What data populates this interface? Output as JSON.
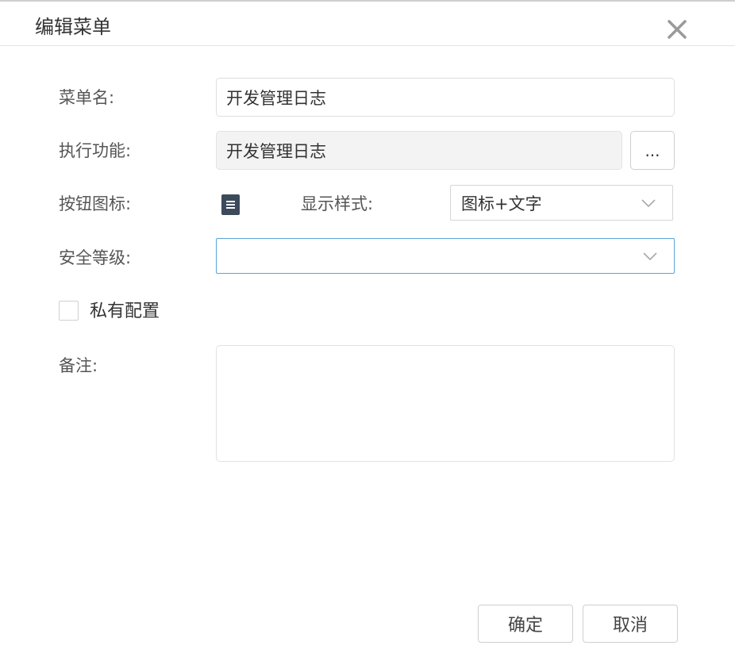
{
  "dialog": {
    "title": "编辑菜单",
    "close_icon": "close-x-icon"
  },
  "form": {
    "menu_name": {
      "label": "菜单名:",
      "value": "开发管理日志"
    },
    "function": {
      "label": "执行功能:",
      "value": "开发管理日志",
      "browse_label": "..."
    },
    "button_icon": {
      "label": "按钮图标:",
      "icon": "list-document-icon"
    },
    "display_style": {
      "label": "显示样式:",
      "selected": "图标+文字",
      "dropdown_icon": "chevron-down-icon"
    },
    "security_level": {
      "label": "安全等级:",
      "selected": "",
      "dropdown_icon": "chevron-down-icon"
    },
    "private_config": {
      "label": "私有配置",
      "checked": false
    },
    "remark": {
      "label": "备注:",
      "value": ""
    }
  },
  "footer": {
    "confirm_label": "确定",
    "cancel_label": "取消"
  },
  "colors": {
    "focus_border": "#5aa5d8",
    "icon_bg": "#3c4a5c",
    "readonly_bg": "#f3f3f3"
  }
}
